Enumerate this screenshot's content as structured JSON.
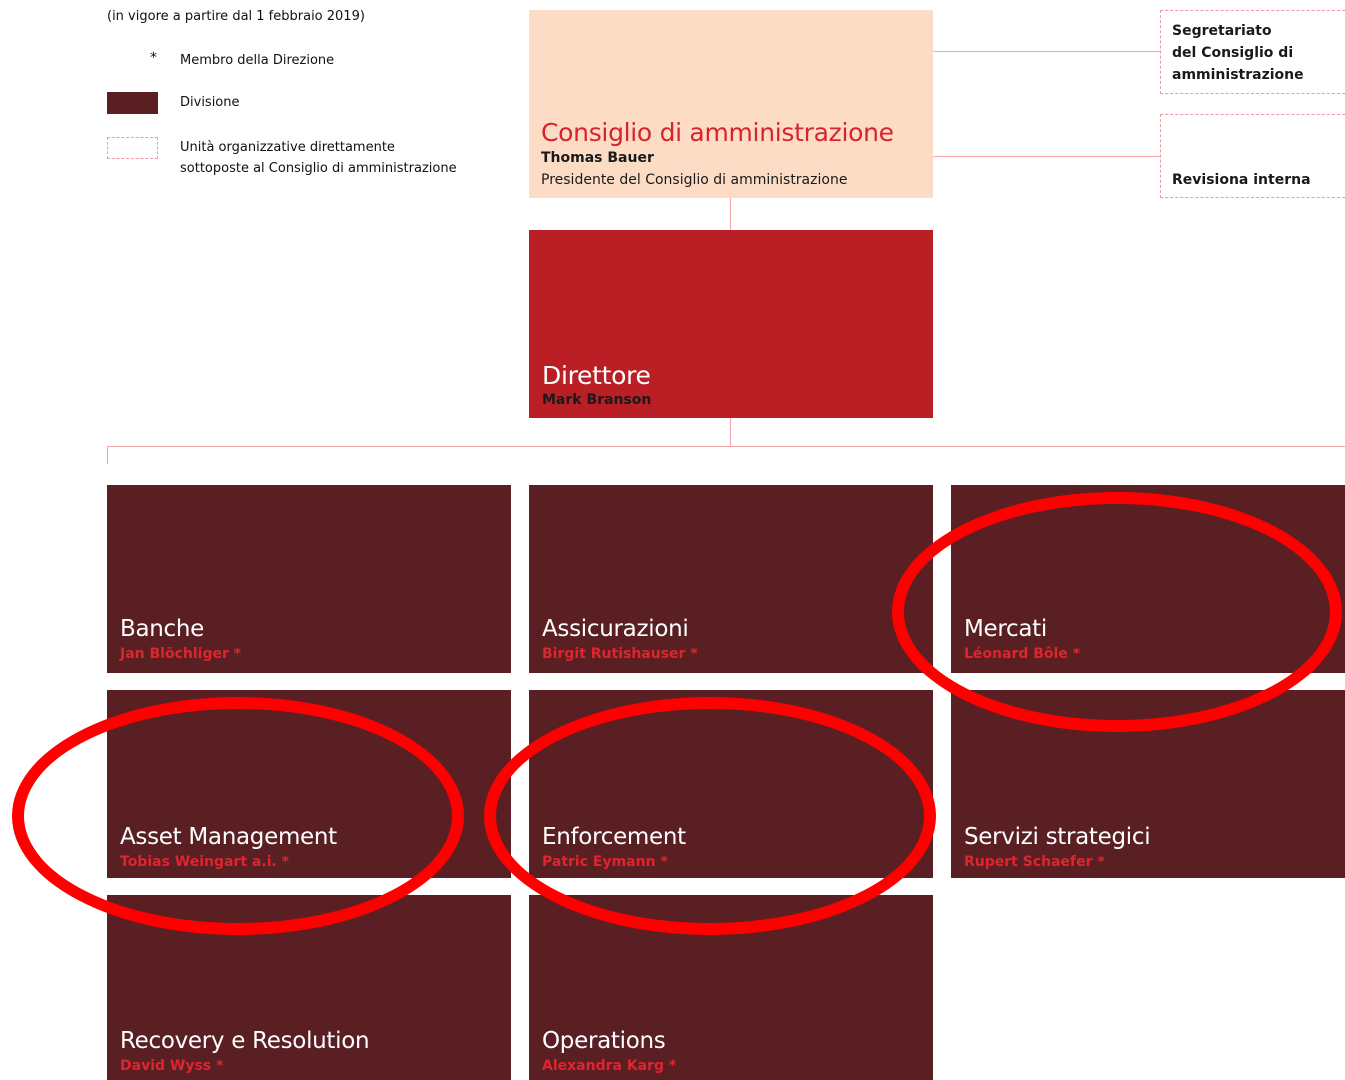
{
  "legend": {
    "date": "(in vigore a partire dal 1 febbraio 2019)",
    "star_symbol": "*",
    "star_label": "Membro della Direzione",
    "division_label": "Divisione",
    "unit_label_line1": "Unità organizzative direttamente",
    "unit_label_line2": "sottoposte al Consiglio di amministrazione"
  },
  "board": {
    "title": "Consiglio di amministrazione",
    "name": "Thomas Bauer",
    "role": "Presidente del Consiglio di amministrazione"
  },
  "side_units": [
    {
      "line1": "Segretariato",
      "line2": "del Consiglio di",
      "line3": "amministrazione"
    },
    {
      "line1": "Revisiona interna"
    }
  ],
  "director": {
    "title": "Direttore",
    "name": "Mark Branson"
  },
  "divisions": [
    {
      "title": "Banche",
      "head": "Jan Blöchliger *",
      "highlighted": false
    },
    {
      "title": "Assicurazioni",
      "head": "Birgit Rutishauser *",
      "highlighted": false
    },
    {
      "title": "Mercati",
      "head": "Léonard Bôle *",
      "highlighted": true
    },
    {
      "title": "Asset Management",
      "head": "Tobias Weingart a.i. *",
      "highlighted": true
    },
    {
      "title": "Enforcement",
      "head": "Patric Eymann *",
      "highlighted": true
    },
    {
      "title": "Servizi strategici",
      "head": "Rupert Schaefer *",
      "highlighted": false
    },
    {
      "title": "Recovery e Resolution",
      "head": "David Wyss *",
      "highlighted": false
    },
    {
      "title": "Operations",
      "head": "Alexandra Karg *",
      "highlighted": false
    }
  ],
  "colors": {
    "board_fill": "#fcdcc4",
    "director_fill": "#ba1f26",
    "division_fill": "#5a1f22",
    "accent_red": "#e0242d",
    "highlight_ring": "#ff0000",
    "connector": "#f2a6a9"
  }
}
